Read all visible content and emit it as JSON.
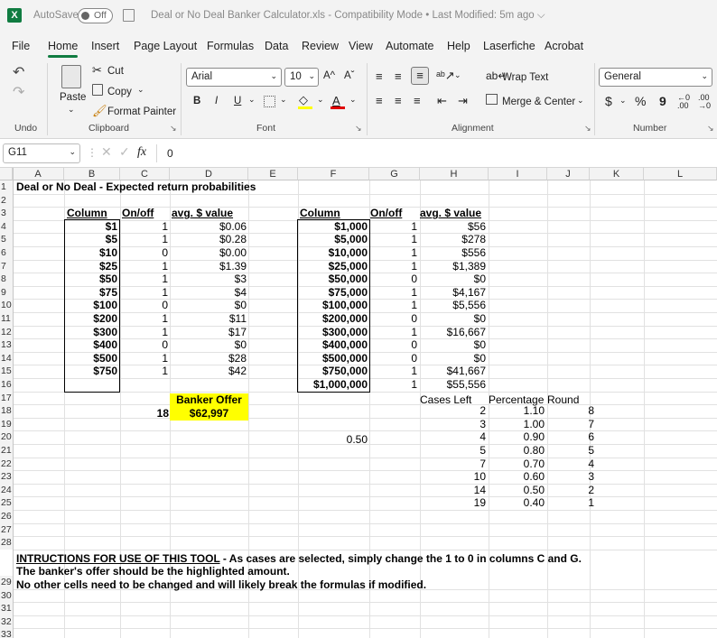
{
  "titlebar": {
    "autosave_label": "AutoSave",
    "autosave_state": "Off",
    "title": "Deal or No Deal Banker Calculator.xls",
    "mode": "Compatibility Mode",
    "modified": "Last Modified: 5m ago",
    "separator": "•"
  },
  "menu": [
    "File",
    "Home",
    "Insert",
    "Page Layout",
    "Formulas",
    "Data",
    "Review",
    "View",
    "Automate",
    "Help",
    "Laserfiche",
    "Acrobat"
  ],
  "ribbon": {
    "clipboard": {
      "paste": "Paste",
      "cut": "Cut",
      "copy": "Copy",
      "format_painter": "Format Painter",
      "group": "Clipboard"
    },
    "undo_group": "Undo",
    "font": {
      "name": "Arial",
      "size": "10",
      "grow": "A^",
      "shrink": "Aˇ",
      "bold": "B",
      "italic": "I",
      "underline": "U",
      "font_color_letter": "A",
      "group": "Font"
    },
    "alignment": {
      "wrap": "Wrap Text",
      "merge": "Merge & Center",
      "group": "Alignment"
    },
    "number": {
      "format": "General",
      "currency": "$",
      "percent": "%",
      "comma": "9",
      "group": "Number"
    }
  },
  "formula_bar": {
    "name_box": "G11",
    "fx": "fx",
    "value": "0"
  },
  "columns": [
    "A",
    "B",
    "C",
    "D",
    "E",
    "F",
    "G",
    "H",
    "I",
    "J",
    "K",
    "L"
  ],
  "rows": [
    "1",
    "2",
    "3",
    "4",
    "5",
    "6",
    "7",
    "8",
    "9",
    "10",
    "11",
    "12",
    "13",
    "14",
    "15",
    "16",
    "17",
    "18",
    "19",
    "20",
    "21",
    "22",
    "23",
    "24",
    "25",
    "26",
    "27",
    "28",
    "29",
    "30",
    "31",
    "32",
    "33"
  ],
  "sheet": {
    "title": "Deal or No Deal - Expected return probabilities",
    "left_headers": {
      "column": "Column",
      "onoff": "On/off",
      "avg": "avg. $ value"
    },
    "left_rows": [
      {
        "amount": "$1",
        "onoff": "1",
        "avg": "$0.06"
      },
      {
        "amount": "$5",
        "onoff": "1",
        "avg": "$0.28"
      },
      {
        "amount": "$10",
        "onoff": "0",
        "avg": "$0.00"
      },
      {
        "amount": "$25",
        "onoff": "1",
        "avg": "$1.39"
      },
      {
        "amount": "$50",
        "onoff": "1",
        "avg": "$3"
      },
      {
        "amount": "$75",
        "onoff": "1",
        "avg": "$4"
      },
      {
        "amount": "$100",
        "onoff": "0",
        "avg": "$0"
      },
      {
        "amount": "$200",
        "onoff": "1",
        "avg": "$11"
      },
      {
        "amount": "$300",
        "onoff": "1",
        "avg": "$17"
      },
      {
        "amount": "$400",
        "onoff": "0",
        "avg": "$0"
      },
      {
        "amount": "$500",
        "onoff": "1",
        "avg": "$28"
      },
      {
        "amount": "$750",
        "onoff": "1",
        "avg": "$42"
      }
    ],
    "right_headers": {
      "column": "Column",
      "onoff": "On/off",
      "avg": "avg. $ value"
    },
    "right_rows": [
      {
        "amount": "$1,000",
        "onoff": "1",
        "avg": "$56"
      },
      {
        "amount": "$5,000",
        "onoff": "1",
        "avg": "$278"
      },
      {
        "amount": "$10,000",
        "onoff": "1",
        "avg": "$556"
      },
      {
        "amount": "$25,000",
        "onoff": "1",
        "avg": "$1,389"
      },
      {
        "amount": "$50,000",
        "onoff": "0",
        "avg": "$0"
      },
      {
        "amount": "$75,000",
        "onoff": "1",
        "avg": "$4,167"
      },
      {
        "amount": "$100,000",
        "onoff": "1",
        "avg": "$5,556"
      },
      {
        "amount": "$200,000",
        "onoff": "0",
        "avg": "$0"
      },
      {
        "amount": "$300,000",
        "onoff": "1",
        "avg": "$16,667"
      },
      {
        "amount": "$400,000",
        "onoff": "0",
        "avg": "$0"
      },
      {
        "amount": "$500,000",
        "onoff": "0",
        "avg": "$0"
      },
      {
        "amount": "$750,000",
        "onoff": "1",
        "avg": "$41,667"
      },
      {
        "amount": "$1,000,000",
        "onoff": "1",
        "avg": "$55,556"
      }
    ],
    "banker_label": "Banker Offer",
    "banker_cases": "18",
    "banker_offer": "$62,997",
    "f20": "0.50",
    "table2_headers": {
      "cases": "Cases Left",
      "pct": "Percentage",
      "round": "Round"
    },
    "table2_rows": [
      {
        "cases": "2",
        "pct": "1.10",
        "round": "8"
      },
      {
        "cases": "3",
        "pct": "1.00",
        "round": "7"
      },
      {
        "cases": "4",
        "pct": "0.90",
        "round": "6"
      },
      {
        "cases": "5",
        "pct": "0.80",
        "round": "5"
      },
      {
        "cases": "7",
        "pct": "0.70",
        "round": "4"
      },
      {
        "cases": "10",
        "pct": "0.60",
        "round": "3"
      },
      {
        "cases": "14",
        "pct": "0.50",
        "round": "2"
      },
      {
        "cases": "19",
        "pct": "0.40",
        "round": "1"
      }
    ],
    "instructions_title": "INTRUCTIONS FOR USE OF THIS TOOL",
    "instructions_1": " - As cases are selected, simply change the 1 to 0 in columns C and G.",
    "instructions_2": "The banker's offer should be the highlighted amount.",
    "instructions_3": "No other cells need to be changed and will likely break the formulas if modified."
  },
  "colors": {
    "excel_green": "#107c41",
    "highlight": "#ffff00",
    "grid": "#e1e1e1"
  }
}
